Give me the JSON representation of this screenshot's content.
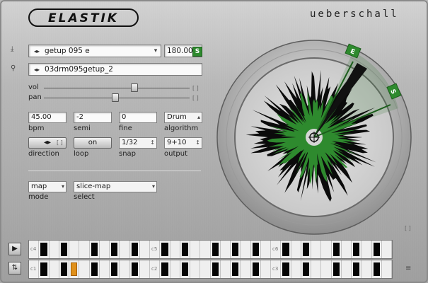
{
  "brand": "ueberschall",
  "logo_text": "ELASTIK",
  "preset": {
    "name": "getup 095 e",
    "tempo": "180.00",
    "sync_badge": "S"
  },
  "sample": {
    "name": "03drm095getup_2"
  },
  "sliders": {
    "vol_label": "vol",
    "pan_label": "pan",
    "bracket": "[ ]",
    "vol_level": 0.62,
    "pan_level": 0.49
  },
  "params": {
    "bpm": {
      "value": "45.00",
      "label": "bpm"
    },
    "semi": {
      "value": "-2",
      "label": "semi"
    },
    "fine": {
      "value": "0",
      "label": "fine"
    },
    "algorithm": {
      "value": "Drum",
      "label": "algorithm"
    },
    "direction": {
      "label": "direction"
    },
    "loop": {
      "value": "on",
      "label": "loop"
    },
    "snap": {
      "value": "1/32",
      "label": "snap"
    },
    "output": {
      "value": "9+10",
      "label": "output"
    }
  },
  "mapping": {
    "mode": {
      "value": "map",
      "label": "mode"
    },
    "select": {
      "value": "slice-map",
      "label": "select"
    }
  },
  "dial": {
    "marker_e": "E",
    "marker_s": "S",
    "bracket": "[ ]"
  },
  "keyboard": {
    "top_labels": [
      "c4",
      "c5",
      "c6"
    ],
    "bottom_labels": [
      "c1",
      "c2",
      "c3"
    ],
    "selected_key": "d1"
  },
  "colors": {
    "accent_green": "#2e8a2e",
    "selected_key": "#e0901a"
  }
}
